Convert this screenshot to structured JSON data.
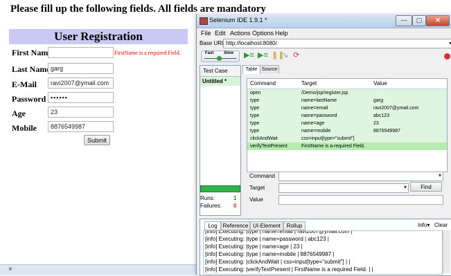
{
  "page": {
    "heading": "Please fill up the following fields. All fields are mandatory"
  },
  "form": {
    "title": "User Registration",
    "fields": [
      {
        "label": "First Name",
        "value": "",
        "error": "FirstName is a required Field."
      },
      {
        "label": "Last Name",
        "value": "garg"
      },
      {
        "label": "E-Mail",
        "value": "ravi2007@ymail.com"
      },
      {
        "label": "Password",
        "value": "••••••"
      },
      {
        "label": "Age",
        "value": "23"
      },
      {
        "label": "Mobile",
        "value": "8876549987"
      }
    ],
    "submit": "Submit"
  },
  "bottom_bar": {
    "close": "×"
  },
  "selenium": {
    "title": "Selenium IDE 1.9.1 *",
    "menu": [
      "File",
      "Edit",
      "Actions",
      "Options",
      "Help"
    ],
    "base_url_label": "Base URL",
    "base_url": "http://localhost:8080/",
    "speed_fast": "Fast",
    "speed_slow": "Slow",
    "testcase_header": "Test Case",
    "testcase_item": "Untitled *",
    "runs_label": "Runs:",
    "runs_value": "1",
    "failures_label": "Failures:",
    "failures_value": "0",
    "tabs": [
      "Table",
      "Source"
    ],
    "columns": [
      "Command",
      "Target",
      "Value"
    ],
    "commands": [
      {
        "command": "open",
        "target": "/Demo/jsp/register.jsp",
        "value": ""
      },
      {
        "command": "type",
        "target": "name=lastName",
        "value": "garg"
      },
      {
        "command": "type",
        "target": "name=email",
        "value": "ravi2007@ymail.com"
      },
      {
        "command": "type",
        "target": "name=password",
        "value": "abc123"
      },
      {
        "command": "type",
        "target": "name=age",
        "value": "23"
      },
      {
        "command": "type",
        "target": "name=mobile",
        "value": "8876549987"
      },
      {
        "command": "clickAndWait",
        "target": "css=input[type=\"submit\"]",
        "value": ""
      },
      {
        "command": "verifyTextPresent",
        "target": "FirstName is a required Field.",
        "value": ""
      }
    ],
    "form_labels": {
      "command": "Command",
      "target": "Target",
      "value": "Value"
    },
    "find": "Find",
    "log_tabs": [
      "Log",
      "Reference",
      "UI-Element",
      "Rollup"
    ],
    "info": "Info▾",
    "clear": "Clear",
    "log_lines": [
      "[info] Executing: |type | name=email | ravi2007@ymail.com |",
      "[info] Executing: |type | name=password | abc123 |",
      "[info] Executing: |type | name=age | 23 |",
      "[info] Executing: |type | name=mobile | 8876549987 |",
      "[info] Executing: |clickAndWait | css=input[type=\"submit\"] | |",
      "[info] Executing: |verifyTextPresent | FirstName is a required Field. | |"
    ]
  }
}
